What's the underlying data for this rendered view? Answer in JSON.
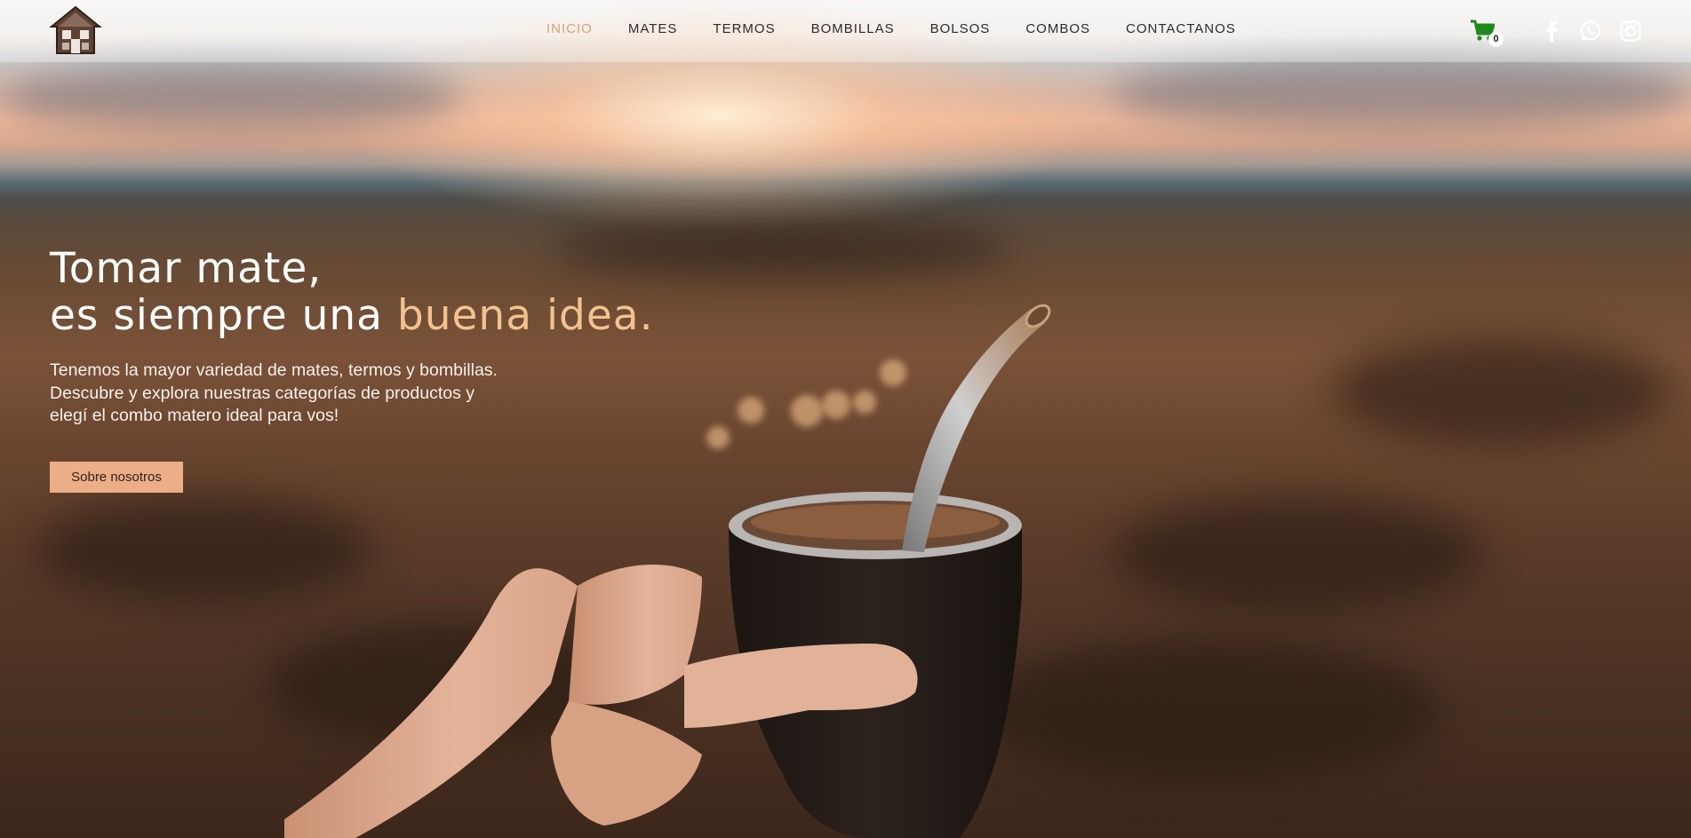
{
  "header": {
    "nav": [
      "INICIO",
      "MATES",
      "TERMOS",
      "BOMBILLAS",
      "BOLSOS",
      "COMBOS",
      "CONTACTANOS"
    ],
    "active_index": 0,
    "cart_count": "0",
    "social_icons": [
      "facebook-icon",
      "whatsapp-icon",
      "instagram-icon"
    ]
  },
  "hero": {
    "title_line1": "Tomar mate,",
    "title_line2_start": "es siempre una ",
    "title_line2_accent": "buena idea.",
    "description_lines": [
      "Tenemos la mayor variedad de mates, termos y bombillas.",
      "Descubre y explora nuestras categorías de productos y",
      "elegí el combo matero ideal para vos!"
    ],
    "button_label": "Sobre nosotros"
  },
  "colors": {
    "accent": "#f2c38f",
    "nav_active": "#d5a27e",
    "button_bg": "#ecae86",
    "cart_green": "#1e8a1e"
  }
}
